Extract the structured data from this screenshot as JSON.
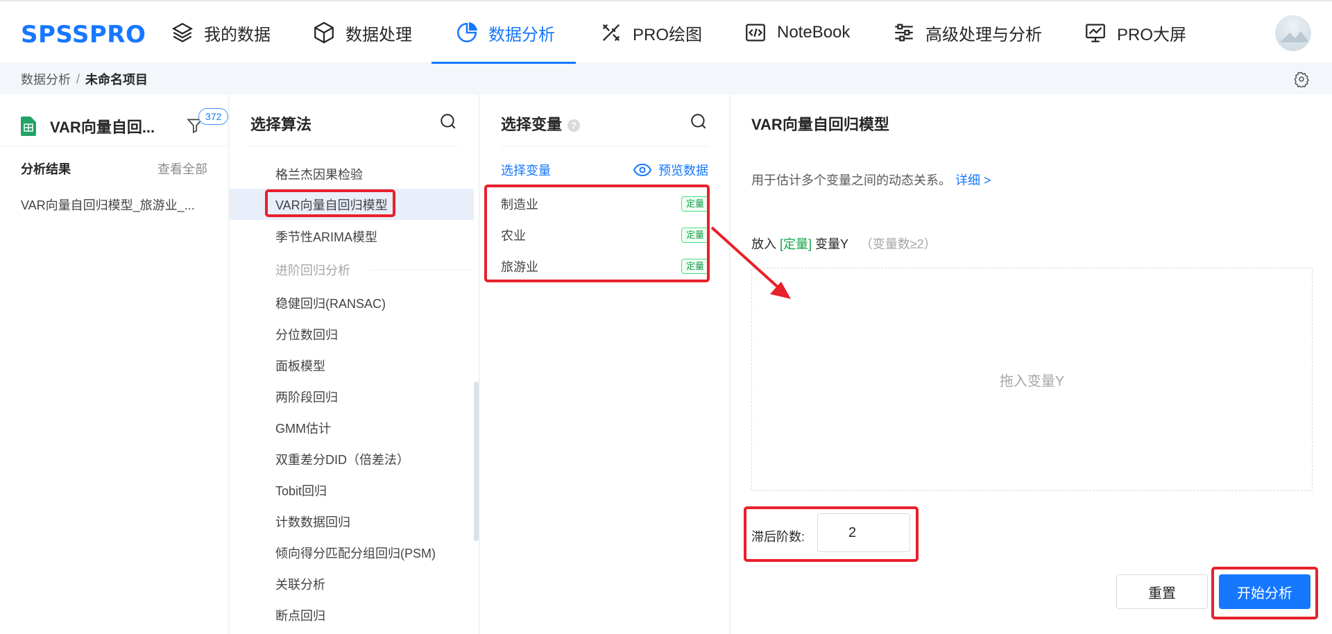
{
  "app": {
    "logo": "SPSSPRO"
  },
  "nav": {
    "items": [
      {
        "label": "我的数据",
        "icon": "layers-icon"
      },
      {
        "label": "数据处理",
        "icon": "cube-icon"
      },
      {
        "label": "数据分析",
        "icon": "pie-chart-icon",
        "active": true
      },
      {
        "label": "PRO绘图",
        "icon": "pen-ruler-icon"
      },
      {
        "label": "NoteBook",
        "icon": "code-file-icon"
      },
      {
        "label": "高级处理与分析",
        "icon": "sliders-icon"
      },
      {
        "label": "PRO大屏",
        "icon": "monitor-chart-icon"
      }
    ]
  },
  "breadcrumb": {
    "root": "数据分析",
    "separator": "/",
    "current": "未命名项目"
  },
  "left_panel": {
    "file_title": "VAR向量自回...",
    "filter_count": "372",
    "results_title": "分析结果",
    "view_all": "查看全部",
    "result_item": "VAR向量自回归模型_旅游业_..."
  },
  "algo_panel": {
    "title": "选择算法",
    "items": [
      {
        "label": "格兰杰因果检验"
      },
      {
        "label": "VAR向量自回归模型",
        "selected": true
      },
      {
        "label": "季节性ARIMA模型"
      },
      {
        "label": "稳健回归(RANSAC)"
      },
      {
        "label": "分位数回归"
      },
      {
        "label": "面板模型"
      },
      {
        "label": "两阶段回归"
      },
      {
        "label": "GMM估计"
      },
      {
        "label": "双重差分DID（倍差法）"
      },
      {
        "label": "Tobit回归"
      },
      {
        "label": "计数数据回归"
      },
      {
        "label": "倾向得分匹配分组回归(PSM)"
      },
      {
        "label": "关联分析"
      },
      {
        "label": "断点回归"
      }
    ],
    "group_label": "进阶回归分析"
  },
  "var_panel": {
    "title": "选择变量",
    "help": "?",
    "tab": "选择变量",
    "preview": "预览数据",
    "variables": [
      {
        "name": "制造业",
        "tag": "定量"
      },
      {
        "name": "农业",
        "tag": "定量"
      },
      {
        "name": "旅游业",
        "tag": "定量"
      }
    ]
  },
  "model_panel": {
    "title": "VAR向量自回归模型",
    "description": "用于估计多个变量之间的动态关系。",
    "detail_link": "详细 >",
    "put_prefix": "放入",
    "put_type": "[定量]",
    "put_var": "变量Y",
    "put_hint": "（变量数≥2）",
    "drop_placeholder": "拖入变量Y",
    "lag_label": "滞后阶数:",
    "lag_value": "2",
    "reset_label": "重置",
    "start_label": "开始分析"
  },
  "colors": {
    "accent": "#1677ff",
    "highlight": "#e8202a",
    "tag_green": "#16a34a"
  }
}
